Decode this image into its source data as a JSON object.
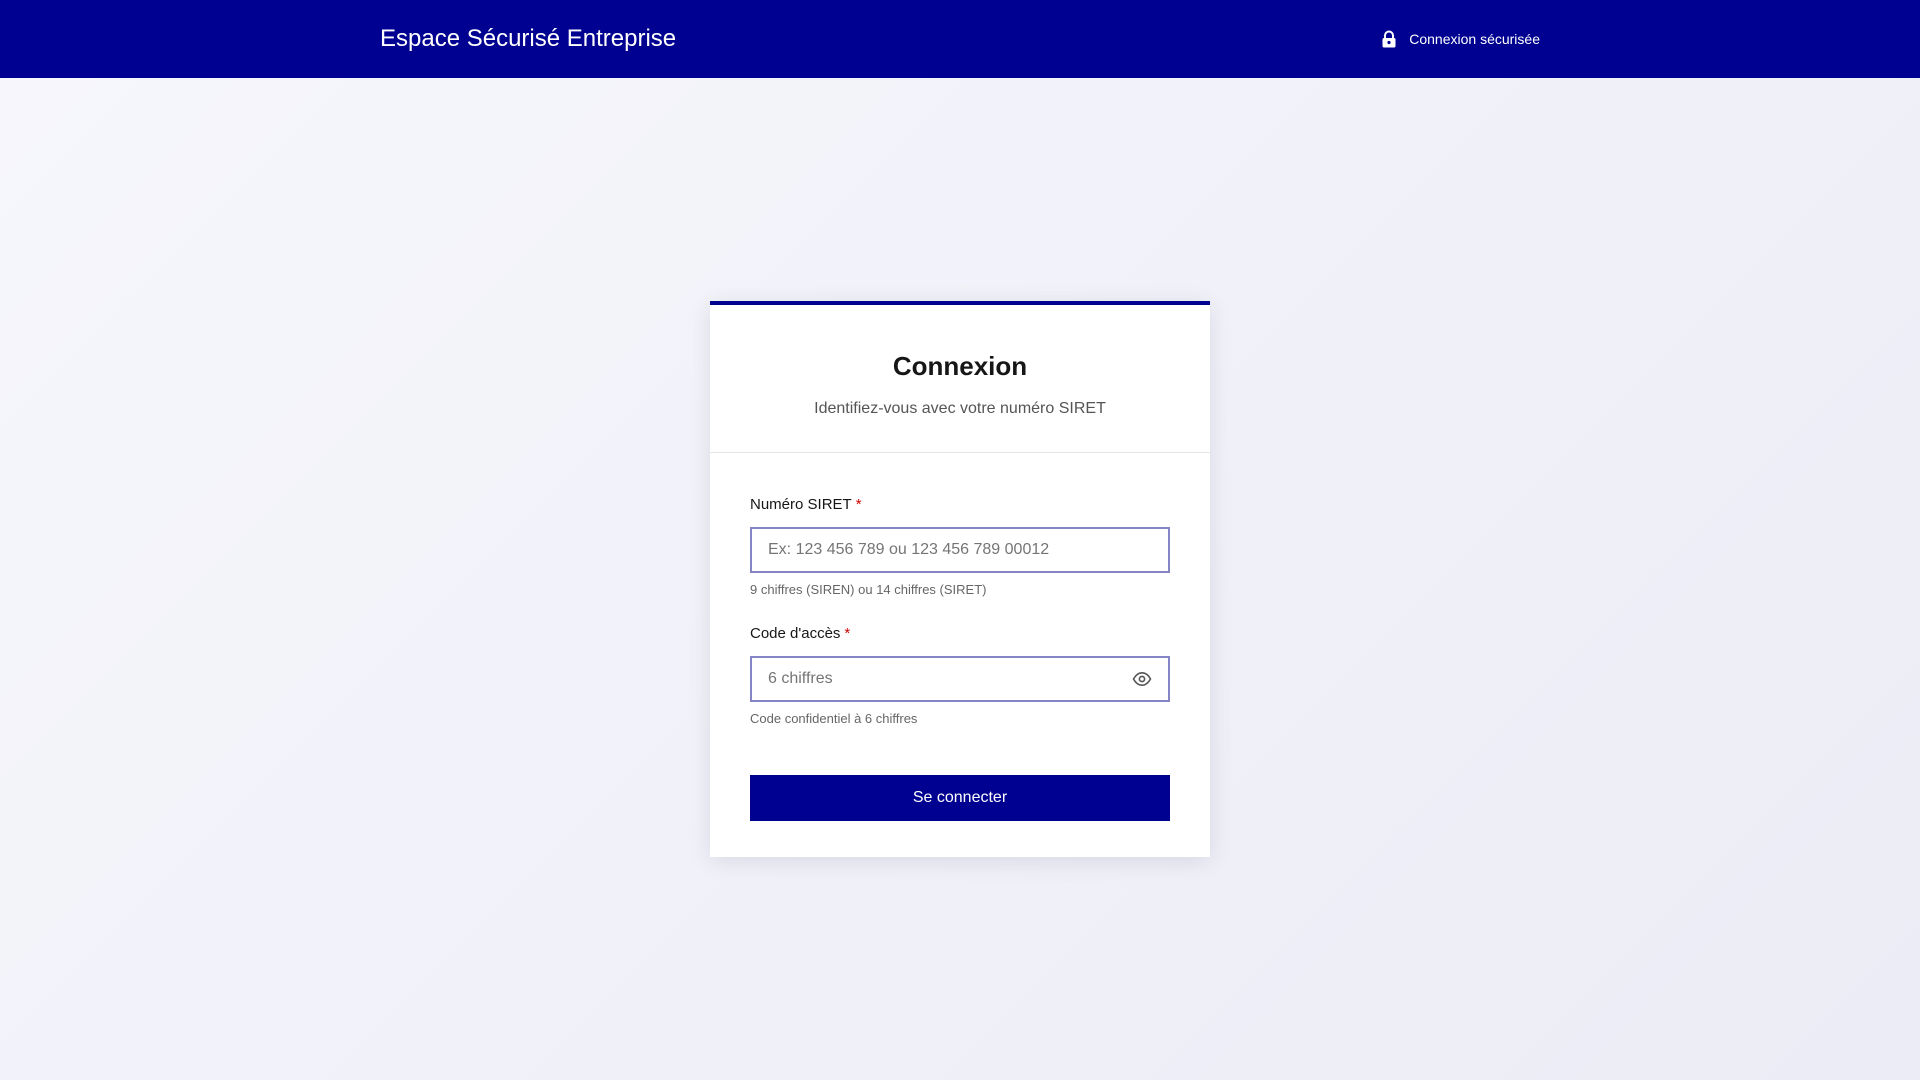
{
  "header": {
    "title": "Espace Sécurisé Entreprise",
    "secure_label": "Connexion sécurisée",
    "secure_icon": "lock-icon",
    "background_color": "#000091"
  },
  "login": {
    "title": "Connexion",
    "subtitle": "Identifiez-vous avec votre numéro SIRET",
    "siret": {
      "label": "Numéro SIRET",
      "required_marker": "*",
      "value": "",
      "placeholder": "Ex: 123 456 789 ou 123 456 789 00012",
      "hint": "9 chiffres (SIREN) ou 14 chiffres (SIRET)"
    },
    "access_code": {
      "label": "Code d'accès",
      "required_marker": "*",
      "value": "",
      "placeholder": "6 chiffres",
      "hint": "Code confidentiel à 6 chiffres",
      "toggle_icon": "eye-icon"
    },
    "submit_label": "Se connecter",
    "accent_color": "#000091",
    "required_color": "#ce0500"
  }
}
